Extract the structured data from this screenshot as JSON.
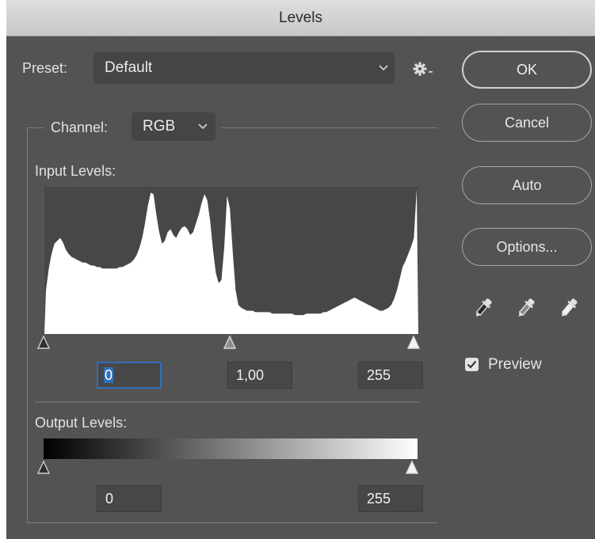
{
  "window": {
    "title": "Levels"
  },
  "preset": {
    "label": "Preset:",
    "value": "Default"
  },
  "channel": {
    "label": "Channel:",
    "value": "RGB"
  },
  "input_levels": {
    "label": "Input Levels:",
    "black": "0",
    "gamma": "1,00",
    "white": "255"
  },
  "output_levels": {
    "label": "Output Levels:",
    "black": "0",
    "white": "255"
  },
  "buttons": {
    "ok": "OK",
    "cancel": "Cancel",
    "auto": "Auto",
    "options": "Options..."
  },
  "preview": {
    "label": "Preview",
    "checked": true
  },
  "icons": {
    "preset_menu": "gear-icon",
    "eyedroppers": [
      "black-point-eyedropper-icon",
      "gray-point-eyedropper-icon",
      "white-point-eyedropper-icon"
    ]
  },
  "colors": {
    "dialog_bg": "#535353",
    "field_bg": "#474747",
    "focus_accent": "#2f6fbf",
    "histogram_fill": "#ffffff"
  },
  "histogram": {
    "levels": [
      30,
      45,
      55,
      62,
      64,
      66,
      63,
      58,
      55,
      53,
      52,
      51,
      50,
      49,
      49,
      48,
      47,
      47,
      46,
      46,
      45,
      45,
      45,
      45,
      45,
      45,
      46,
      46,
      47,
      48,
      49,
      51,
      54,
      59,
      66,
      76,
      88,
      97,
      96,
      82,
      70,
      62,
      64,
      70,
      72,
      68,
      66,
      70,
      73,
      74,
      72,
      68,
      70,
      76,
      82,
      90,
      96,
      92,
      78,
      58,
      42,
      35,
      37,
      60,
      95,
      86,
      56,
      30,
      20,
      18,
      17,
      16,
      16,
      16,
      15,
      15,
      15,
      15,
      15,
      15,
      14,
      14,
      14,
      14,
      14,
      14,
      14,
      14,
      13,
      13,
      13,
      13,
      14,
      14,
      14,
      14,
      14,
      14,
      15,
      15,
      16,
      17,
      18,
      19,
      20,
      21,
      22,
      23,
      24,
      25,
      24,
      23,
      22,
      21,
      20,
      19,
      18,
      17,
      16,
      16,
      17,
      18,
      20,
      24,
      30,
      38,
      46,
      50,
      55,
      60,
      66,
      100
    ]
  }
}
